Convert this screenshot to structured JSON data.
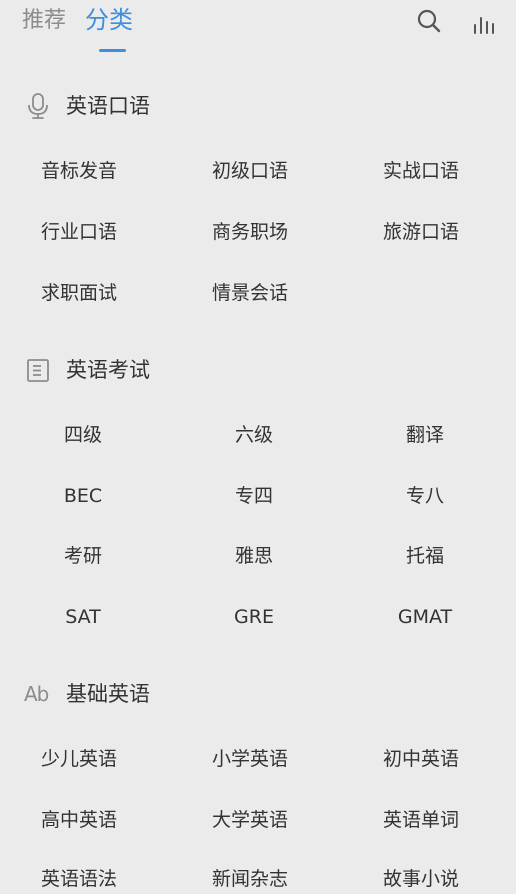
{
  "header": {
    "tabs": [
      {
        "label": "推荐",
        "active": false
      },
      {
        "label": "分类",
        "active": true
      }
    ],
    "icons": [
      "search-icon",
      "chart-bars-icon"
    ],
    "accent_color": "#3d8ee0"
  },
  "sections": [
    {
      "icon": "microphone-icon",
      "title": "英语口语",
      "items": [
        "音标发音",
        "初级口语",
        "实战口语",
        "行业口语",
        "商务职场",
        "旅游口语",
        "求职面试",
        "情景会话"
      ]
    },
    {
      "icon": "document-list-icon",
      "title": "英语考试",
      "items": [
        "四级",
        "六级",
        "翻译",
        "BEC",
        "专四",
        "专八",
        "考研",
        "雅思",
        "托福",
        "SAT",
        "GRE",
        "GMAT"
      ]
    },
    {
      "icon": "ab-text-icon",
      "icon_text": "Ab",
      "title": "基础英语",
      "items": [
        "少儿英语",
        "小学英语",
        "初中英语",
        "高中英语",
        "大学英语",
        "英语单词",
        "英语语法",
        "新闻杂志",
        "故事小说"
      ]
    }
  ]
}
